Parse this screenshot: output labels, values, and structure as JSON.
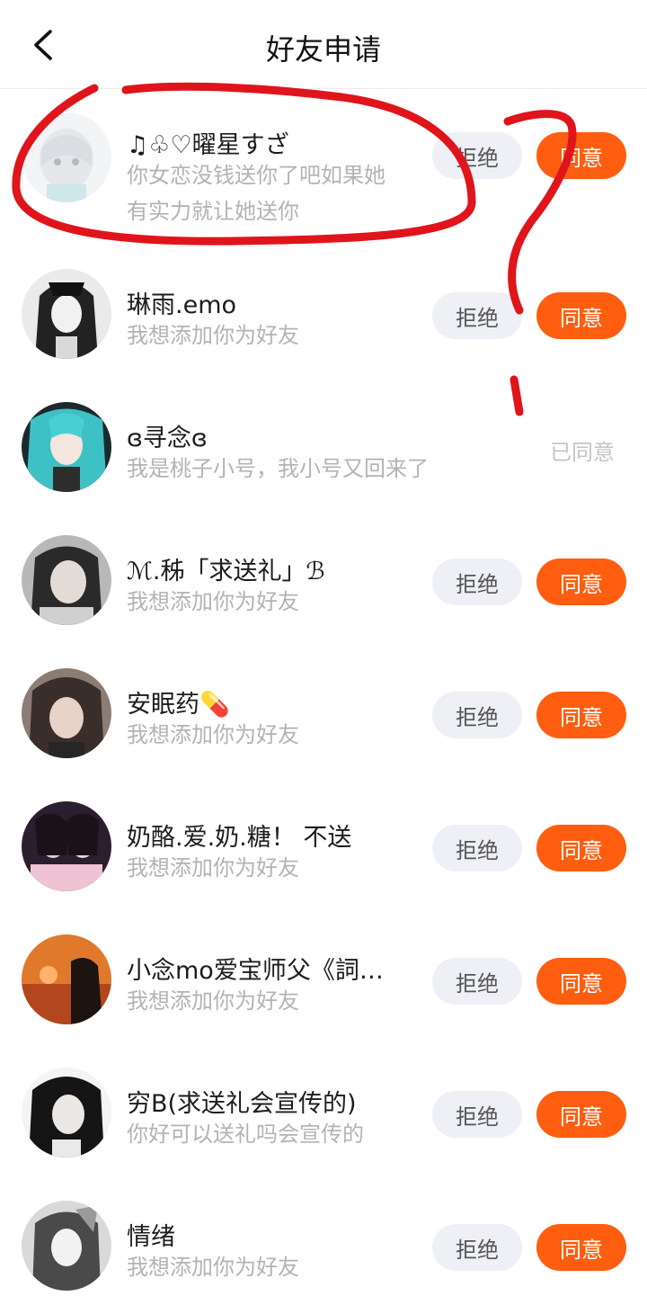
{
  "header": {
    "title": "好友申请",
    "back_icon": "chevron-left-icon"
  },
  "requests": [
    {
      "name": "♫♧♡曜星すざ",
      "message_line1": "你女恋没钱送你了吧如果她",
      "message_line2": "有实力就让她送你",
      "status": "pending",
      "reject_label": "拒绝",
      "agree_label": "同意"
    },
    {
      "name": "琳雨.emo",
      "message": "我想添加你为好友",
      "status": "pending",
      "reject_label": "拒绝",
      "agree_label": "同意"
    },
    {
      "name": "ɞ寻念ɞ",
      "message": "我是桃子小号，我小号又回来了",
      "status": "agreed",
      "status_label": "已同意"
    },
    {
      "name": "ℳ.秭「求送礼」ℬ",
      "message": "我想添加你为好友",
      "status": "pending",
      "reject_label": "拒绝",
      "agree_label": "同意"
    },
    {
      "name": "安眠药💊",
      "message": "我想添加你为好友",
      "status": "pending",
      "reject_label": "拒绝",
      "agree_label": "同意"
    },
    {
      "name": "奶酪.爱.奶.糖！ 不送",
      "message": "我想添加你为好友",
      "status": "pending",
      "reject_label": "拒绝",
      "agree_label": "同意"
    },
    {
      "name": "小念mo爱宝师父《詞…",
      "message": "我想添加你为好友",
      "status": "pending",
      "reject_label": "拒绝",
      "agree_label": "同意"
    },
    {
      "name": "穷B(求送礼会宣传的)",
      "message": "你好可以送礼吗会宣传的",
      "status": "pending",
      "reject_label": "拒绝",
      "agree_label": "同意"
    },
    {
      "name": "情绪",
      "message": "我想添加你为好友",
      "status": "pending",
      "reject_label": "拒绝",
      "agree_label": "同意"
    }
  ],
  "colors": {
    "agree_button": "#ff5d0f",
    "reject_button": "#eef0f5",
    "annotation_ink": "#e0141b"
  }
}
